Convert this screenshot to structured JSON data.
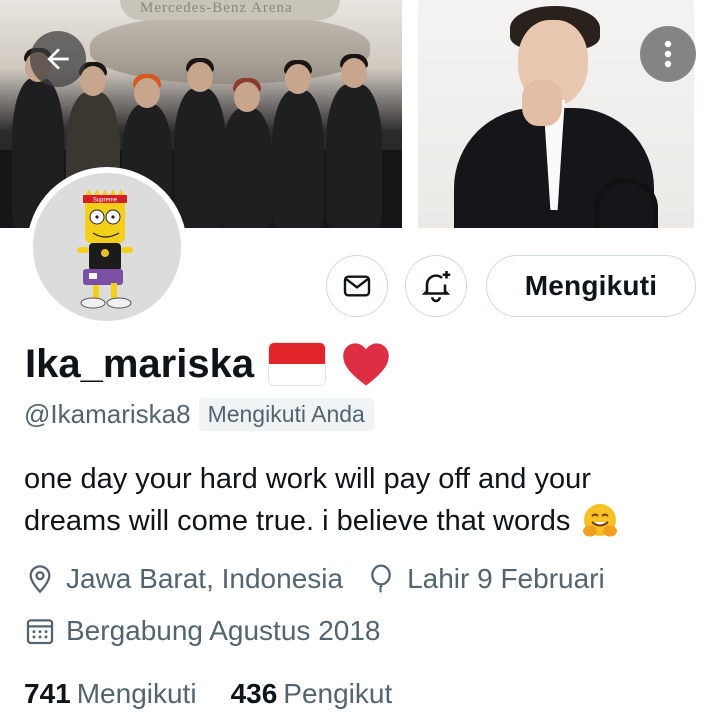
{
  "banner": {
    "sign_text": "Mercedes-Benz Arena"
  },
  "header": {
    "back_icon": "arrow-left-icon",
    "more_icon": "more-vertical-icon"
  },
  "avatar": {
    "cap_text": "Supreme"
  },
  "actions": {
    "message_icon": "envelope-icon",
    "notify_icon": "bell-plus-icon",
    "follow_label": "Mengikuti"
  },
  "profile": {
    "display_name": "Ika_mariska",
    "flag_emoji": "🇮🇩",
    "heart_emoji": "❤️",
    "handle": "@Ikamariska8",
    "follows_you": "Mengikuti Anda",
    "bio_line1": "one day your hard work will pay off and your",
    "bio_line2": "dreams will come true. i believe that words",
    "bio_emoji": "🤗",
    "location": "Jawa Barat, Indonesia",
    "birthday": "Lahir 9 Februari",
    "joined": "Bergabung Agustus 2018"
  },
  "stats": {
    "following_count": "741",
    "following_label": "Mengikuti",
    "followers_count": "436",
    "followers_label": "Pengikut"
  },
  "colors": {
    "text_primary": "#0f1419",
    "text_secondary": "#536471",
    "border": "#cfd9de",
    "flag_red": "#e0262b",
    "heart_red": "#dd2e44"
  }
}
